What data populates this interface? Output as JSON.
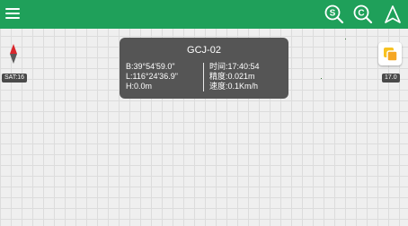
{
  "topbar": {
    "background": "#1fa05a",
    "icons": [
      "menu-icon",
      "search-s-icon",
      "search-c-icon",
      "navigate-icon"
    ]
  },
  "status": {
    "satellites": "SAT:16",
    "zoom": "17.0"
  },
  "info_panel": {
    "title": "GCJ-02",
    "latitude": "B:39°54'59.0\"",
    "longitude": "L:116°24'36.9\"",
    "height": "H:0.0m",
    "time": "时间:17:40:54",
    "accuracy": "精度:0.021m",
    "speed": "速度:0.1Km/h"
  },
  "map": {
    "background": "#efefef",
    "grid_color": "#dcdcdc"
  }
}
